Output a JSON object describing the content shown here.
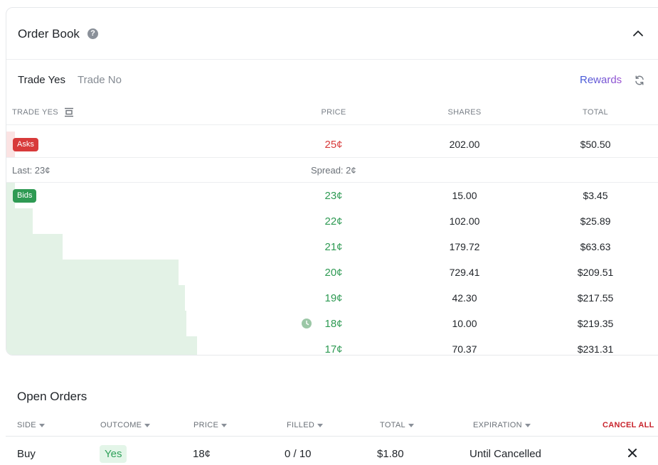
{
  "order_book": {
    "title": "Order Book",
    "help_glyph": "?",
    "tabs": [
      "Trade Yes",
      "Trade No"
    ],
    "rewards_label": "Rewards",
    "columns": [
      "TRADE YES",
      "PRICE",
      "SHARES",
      "TOTAL"
    ],
    "asks_label": "Asks",
    "bids_label": "Bids",
    "last": "Last: 23¢",
    "spread": "Spread: 2¢",
    "asks": [
      {
        "price": "25¢",
        "shares": "202.00",
        "total": "$50.50",
        "depth": 0.013
      }
    ],
    "bids": [
      {
        "price": "23¢",
        "shares": "15.00",
        "total": "$3.45",
        "depth": 0.013
      },
      {
        "price": "22¢",
        "shares": "102.00",
        "total": "$25.89",
        "depth": 0.04
      },
      {
        "price": "21¢",
        "shares": "179.72",
        "total": "$63.63",
        "depth": 0.085
      },
      {
        "price": "20¢",
        "shares": "729.41",
        "total": "$209.51",
        "depth": 0.26
      },
      {
        "price": "19¢",
        "shares": "42.30",
        "total": "$217.55",
        "depth": 0.27
      },
      {
        "price": "18¢",
        "shares": "10.00",
        "total": "$219.35",
        "depth": 0.272,
        "has_order": true
      },
      {
        "price": "17¢",
        "shares": "70.37",
        "total": "$231.31",
        "depth": 0.288
      }
    ]
  },
  "open_orders": {
    "title": "Open Orders",
    "columns": [
      "SIDE",
      "OUTCOME",
      "PRICE",
      "FILLED",
      "TOTAL",
      "EXPIRATION"
    ],
    "cancel_all": "CANCEL ALL",
    "rows": [
      {
        "side": "Buy",
        "outcome": "Yes",
        "price": "18¢",
        "filled": "0 / 10",
        "total": "$1.80",
        "expiration": "Until Cancelled"
      }
    ]
  },
  "colors": {
    "ask": "#d83a3a",
    "bid": "#2e9a53",
    "cancel": "#c8232c"
  }
}
